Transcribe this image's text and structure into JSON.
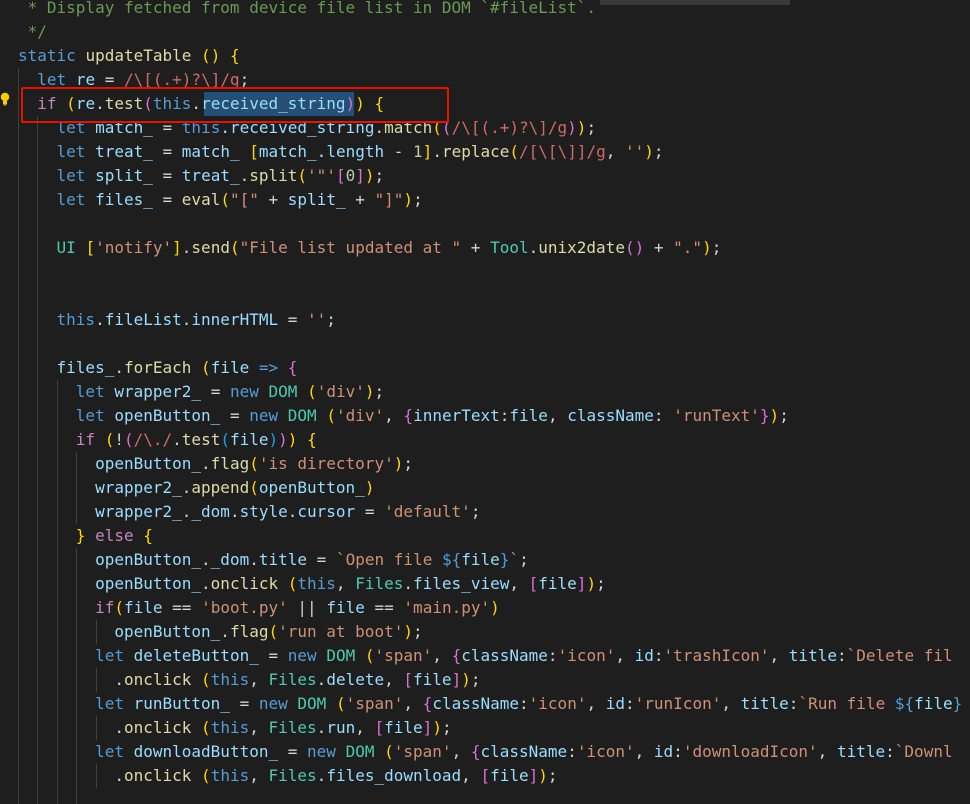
{
  "editor": {
    "language": "javascript",
    "theme_colors": {
      "background": "#1e1e1e",
      "highlight_box": "#e51400",
      "selection": "#264f78"
    },
    "highlighted_line": 4,
    "selected_token": "received_string",
    "lines": [
      " * Display fetched from device file list in DOM `#fileList`.",
      " */",
      "static updateTable () {",
      "  let re = /\\[(.+)?\\]/g;",
      "  if (re.test(this.received_string)) {",
      "    let match_ = this.received_string.match((/\\[(.+)?\\]/g));",
      "    let treat_ = match_ [match_.length - 1].replace(/[\\[\\]]/g, '');",
      "    let split_ = treat_.split('\"'[0]);",
      "    let files_ = eval(\"[\" + split_ + \"]\");",
      "",
      "    UI ['notify'].send(\"File list updated at \" + Tool.unix2date() + \".\");",
      "",
      "",
      "    this.fileList.innerHTML = '';",
      "",
      "    files_.forEach (file => {",
      "      let wrapper2_ = new DOM ('div');",
      "      let openButton_ = new DOM ('div', {innerText:file, className: 'runText'});",
      "      if (!(/\\./.test(file))) {",
      "        openButton_.flag('is directory');",
      "        wrapper2_.append(openButton_)",
      "        wrapper2_._dom.style.cursor = 'default';",
      "      } else {",
      "        openButton_._dom.title = `Open file ${file}`;",
      "        openButton_.onclick (this, Files.files_view, [file]);",
      "        if(file == 'boot.py' || file == 'main.py')",
      "          openButton_.flag('run at boot');",
      "        let deleteButton_ = new DOM ('span', {className:'icon', id:'trashIcon', title:`Delete fil",
      "          .onclick (this, Files.delete, [file]);",
      "        let runButton_ = new DOM ('span', {className:'icon', id:'runIcon', title:`Run file ${file",
      "          .onclick (this, Files.run, [file]);",
      "        let downloadButton_ = new DOM ('span', {className:'icon', id:'downloadIcon', title:`Downl",
      "          .onclick (this, Files.files_download, [file]);",
      ""
    ]
  }
}
